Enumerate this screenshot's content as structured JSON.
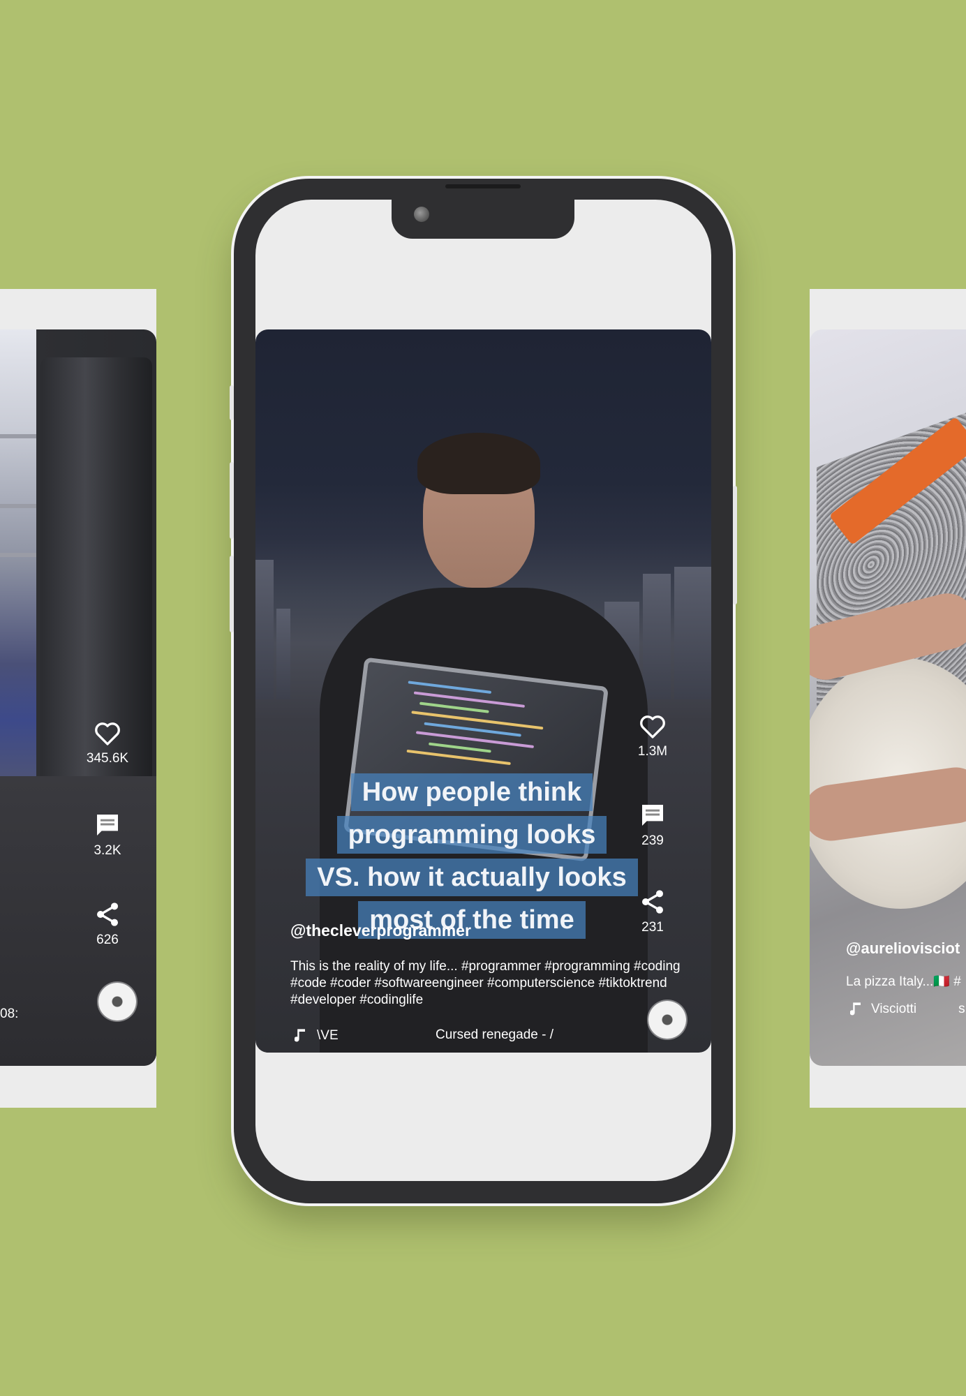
{
  "left_card": {
    "likes": "345.6K",
    "comments": "3.2K",
    "shares": "626",
    "music_fragment": "08:"
  },
  "center_card": {
    "caption_lines": [
      "How people think",
      "programming looks",
      "VS. how it actually looks",
      "most of the time"
    ],
    "handle": "@thecleverprogrammer",
    "description": "This is the reality of my life... #programmer #programming #coding #code #coder #softwareengineer #computerscience #tiktoktrend #developer #codinglife",
    "music_left": "\\VE",
    "music_right": "Cursed renegade - /",
    "likes": "1.3M",
    "comments": "239",
    "shares": "231"
  },
  "right_card": {
    "handle": "@aureliovisciot",
    "description": "La pizza Italy...🇮🇹 #",
    "music": "Visciotti",
    "music_right": "s"
  },
  "icons": [
    "heart-icon",
    "comment-icon",
    "share-icon",
    "music-note-icon",
    "music-disc-icon"
  ],
  "colors": {
    "background": "#afc06f",
    "caption_bg": "#4682be",
    "phone_frame": "#2f2f31"
  }
}
